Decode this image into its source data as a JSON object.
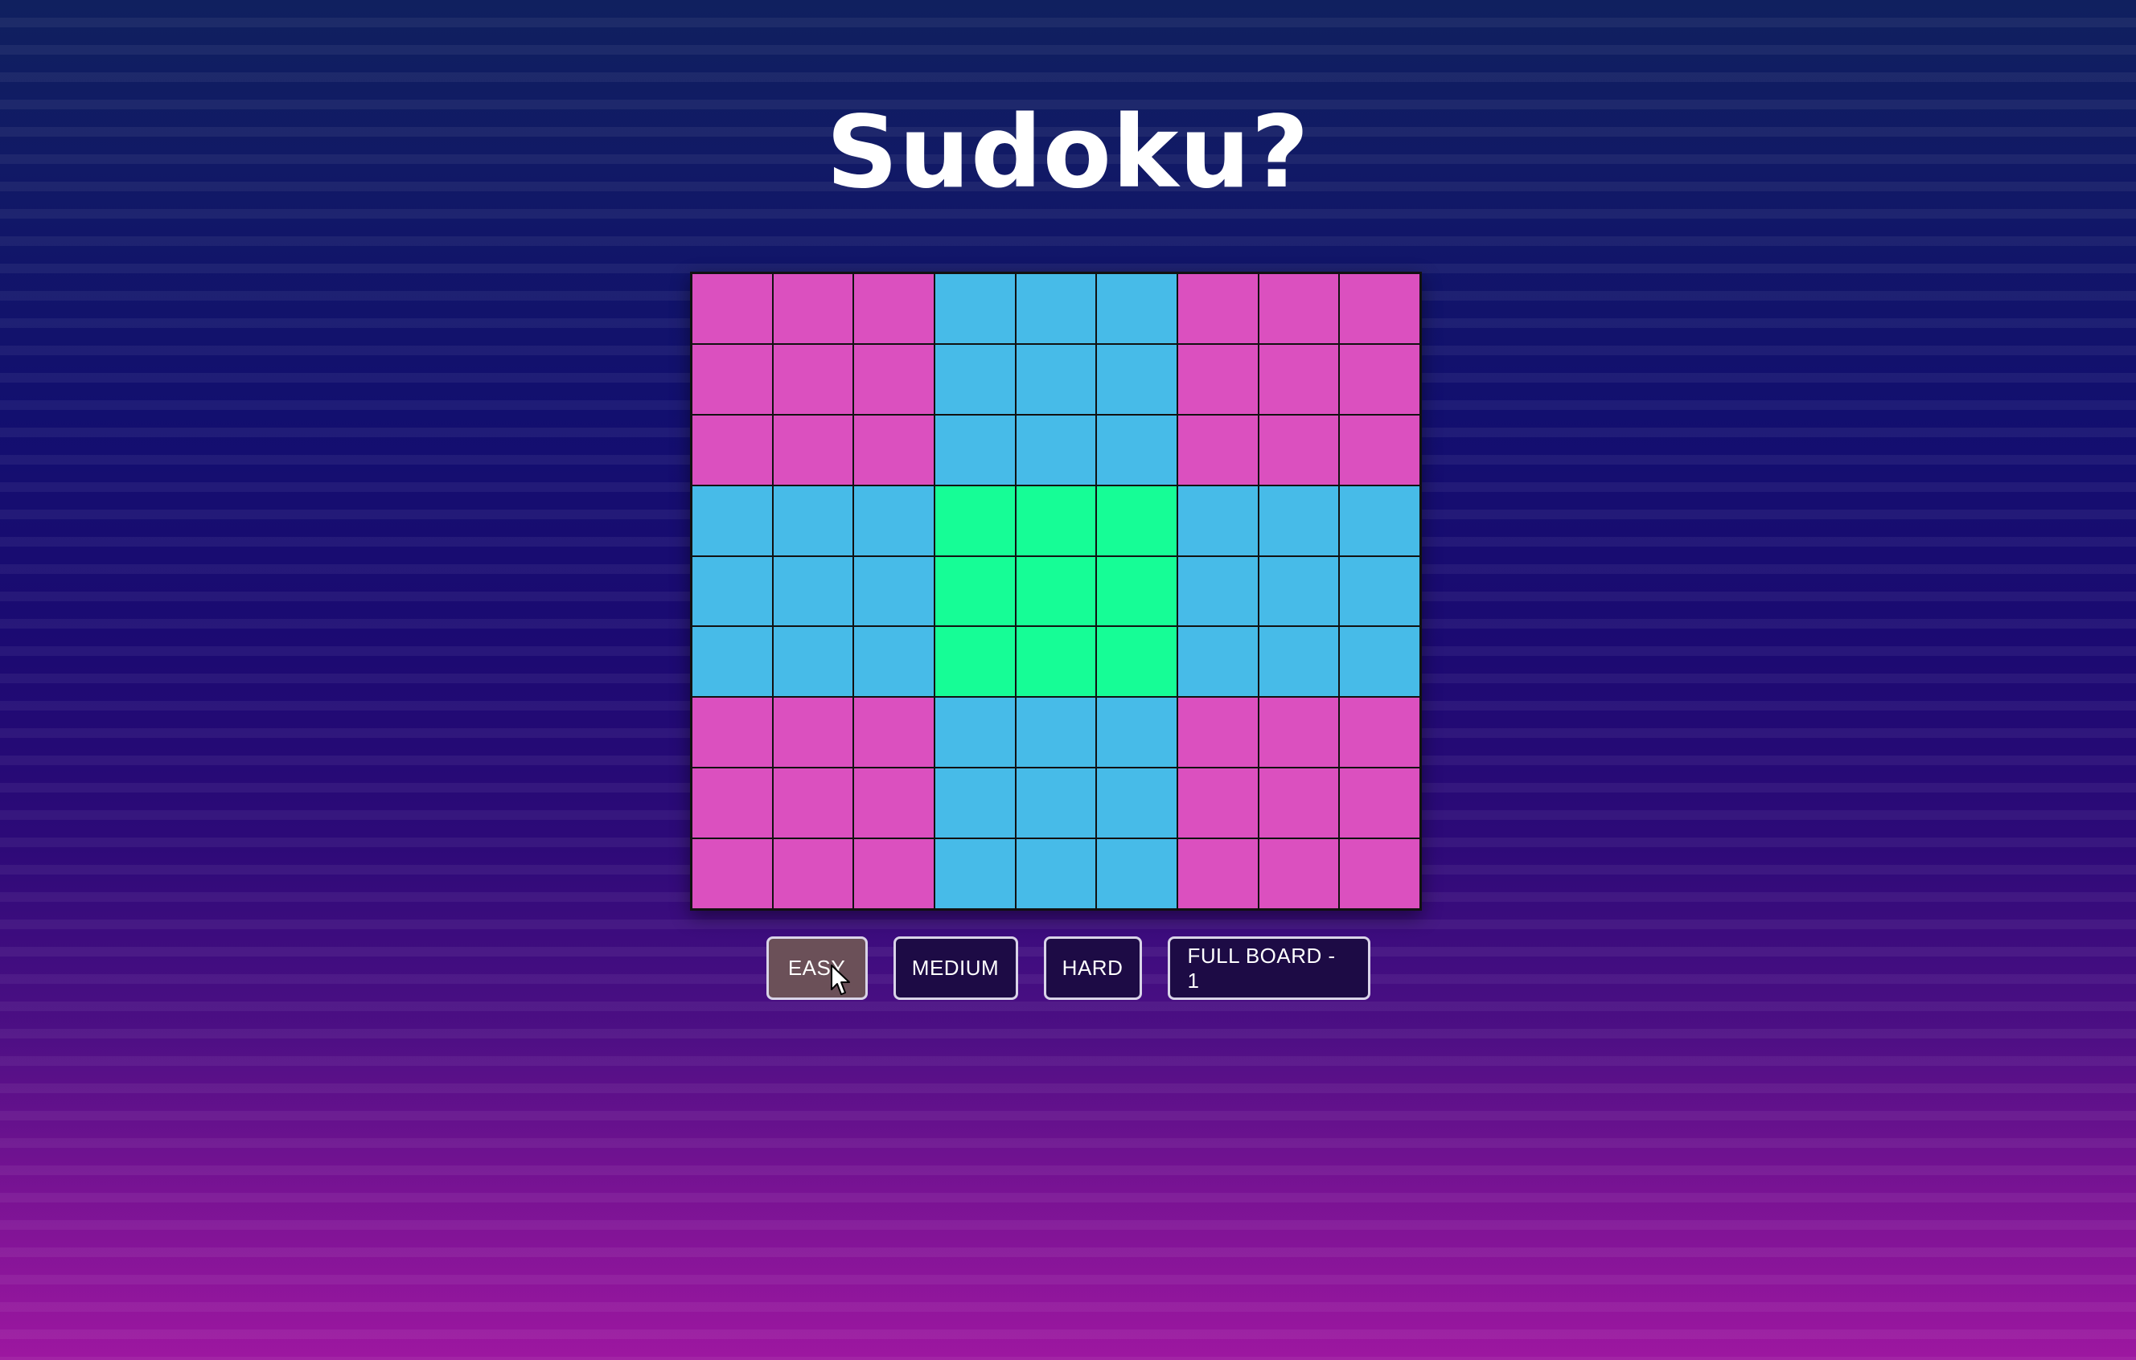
{
  "title": "Sudoku?",
  "colors": {
    "corner_box": "#db50bf",
    "edge_box": "#47bbe8",
    "center_box": "#16fd96",
    "grid_line": "#111111"
  },
  "board": {
    "rows": 9,
    "cols": 9,
    "box_colors": [
      [
        "corner_box",
        "edge_box",
        "corner_box"
      ],
      [
        "edge_box",
        "center_box",
        "edge_box"
      ],
      [
        "corner_box",
        "edge_box",
        "corner_box"
      ]
    ]
  },
  "buttons": [
    {
      "label": "EASY",
      "active": true
    },
    {
      "label": "MEDIUM",
      "active": false
    },
    {
      "label": "HARD",
      "active": false
    },
    {
      "label": "FULL BOARD - 1",
      "active": false
    }
  ],
  "cursor_icon": "mouse-pointer-icon"
}
